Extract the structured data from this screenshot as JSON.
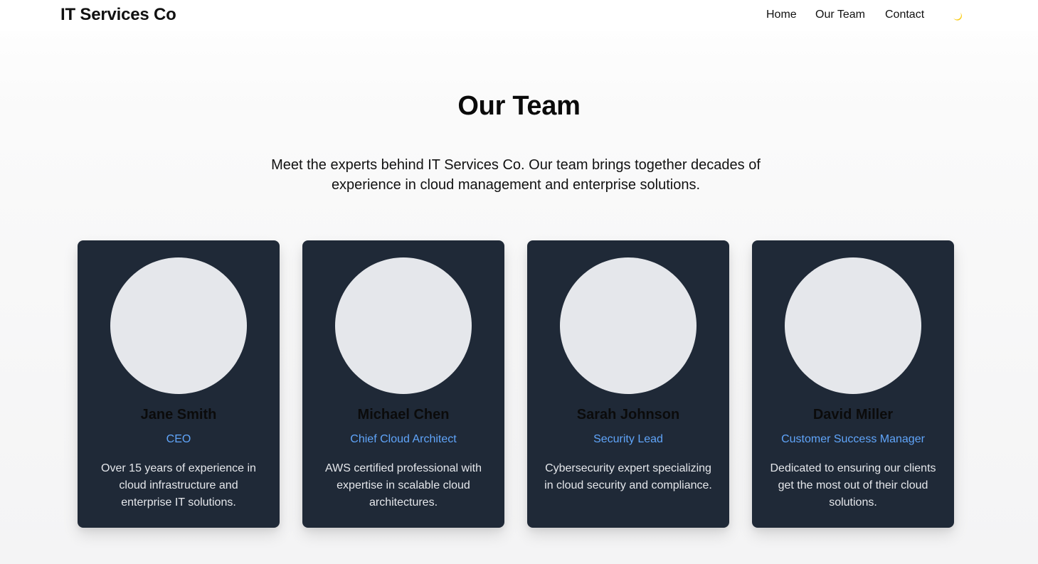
{
  "header": {
    "brand": "IT Services Co",
    "nav": [
      {
        "label": "Home"
      },
      {
        "label": "Our Team"
      },
      {
        "label": "Contact"
      }
    ],
    "theme_toggle_icon": "moon-icon"
  },
  "main": {
    "title": "Our Team",
    "intro": "Meet the experts behind IT Services Co. Our team brings together decades of experience in cloud management and enterprise solutions."
  },
  "team": [
    {
      "name": "Jane Smith",
      "role": "CEO",
      "bio": "Over 15 years of experience in cloud infrastructure and enterprise IT solutions."
    },
    {
      "name": "Michael Chen",
      "role": "Chief Cloud Architect",
      "bio": "AWS certified professional with expertise in scalable cloud architectures."
    },
    {
      "name": "Sarah Johnson",
      "role": "Security Lead",
      "bio": "Cybersecurity expert specializing in cloud security and compliance."
    },
    {
      "name": "David Miller",
      "role": "Customer Success Manager",
      "bio": "Dedicated to ensuring our clients get the most out of their cloud solutions."
    }
  ],
  "colors": {
    "card_background": "#1f2937",
    "avatar_placeholder": "#e5e7eb",
    "role_accent": "#60a5fa",
    "moon_icon": "#facc15"
  }
}
